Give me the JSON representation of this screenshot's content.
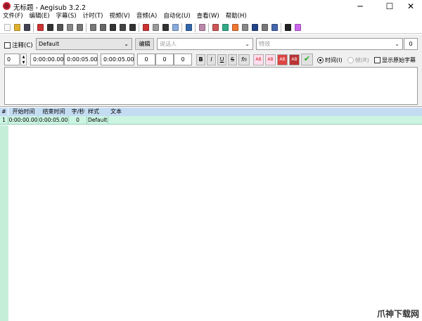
{
  "window": {
    "title": "无标题 - Aegisub 3.2.2",
    "minimize": "─",
    "maximize": "☐",
    "close": "✕"
  },
  "menu": [
    "文件(F)",
    "编辑(E)",
    "字幕(S)",
    "计时(T)",
    "视频(V)",
    "音频(A)",
    "自动化(U)",
    "查看(W)",
    "帮助(H)"
  ],
  "toolbar": {
    "icons": [
      [
        "new-file-icon",
        "#f8f8f8"
      ],
      [
        "open-folder-icon",
        "#e0b030"
      ],
      [
        "save-icon",
        "#445"
      ],
      "|",
      [
        "arrow-right-icon",
        "#c33"
      ],
      [
        "pin-icon",
        "#333"
      ],
      [
        "pin-alt-icon",
        "#555"
      ],
      [
        "properties-icon",
        "#888"
      ],
      [
        "attachments-icon",
        "#777"
      ],
      "|",
      [
        "styles-manager-icon",
        "#777"
      ],
      [
        "style-icon",
        "#666"
      ],
      [
        "fonts-collector-icon",
        "#333"
      ],
      [
        "resample-icon",
        "#444"
      ],
      [
        "translation-icon",
        "#333"
      ],
      "|",
      [
        "spellcheck-icon",
        "#c33"
      ],
      [
        "notes-icon",
        "#999"
      ],
      [
        "pen-icon",
        "#333"
      ],
      [
        "copy-icon",
        "#8ad"
      ],
      "|",
      [
        "automation-icon",
        "#36a"
      ],
      "|",
      [
        "timing-icon",
        "#b8a"
      ],
      "|",
      [
        "video-icon",
        "#c55"
      ],
      [
        "bird-icon",
        "#3a8"
      ],
      [
        "shift-icon",
        "#e73"
      ],
      [
        "stop-icon",
        "#888"
      ],
      [
        "clock-icon",
        "#248"
      ],
      [
        "snapshot-icon",
        "#777"
      ],
      [
        "check-icon",
        "#46a"
      ],
      "|",
      [
        "tools-icon",
        "#222"
      ],
      [
        "kanji-icon",
        "#c6e"
      ]
    ]
  },
  "edit": {
    "comment_label": "注释(C)",
    "style": "Default",
    "edit_button": "编辑",
    "actor_placeholder": "说话人",
    "effect_placeholder": "特效",
    "effect_count": "0",
    "layer": "0",
    "start": "0:00:00.00",
    "end": "0:00:05.00",
    "duration": "0:00:05.00",
    "margin_l": "0",
    "margin_r": "0",
    "margin_v": "0",
    "bold": "B",
    "italic": "I",
    "underline": "U",
    "strike": "S",
    "font": "fn",
    "color1": "AB",
    "color2": "AB",
    "color3": "AB",
    "color4": "AB",
    "commit": "✔",
    "time_label": "时间(I)",
    "frame_label": "帧(R)",
    "show_original_label": "显示原始字幕"
  },
  "grid": {
    "headers": [
      "#",
      "开始时间",
      "结束时间",
      "字/秒",
      "样式",
      "文本"
    ],
    "rows": [
      [
        "1",
        "0:00:00.00",
        "0:00:05.00",
        "0",
        "Default",
        ""
      ]
    ]
  },
  "watermark": "爪神下载网"
}
